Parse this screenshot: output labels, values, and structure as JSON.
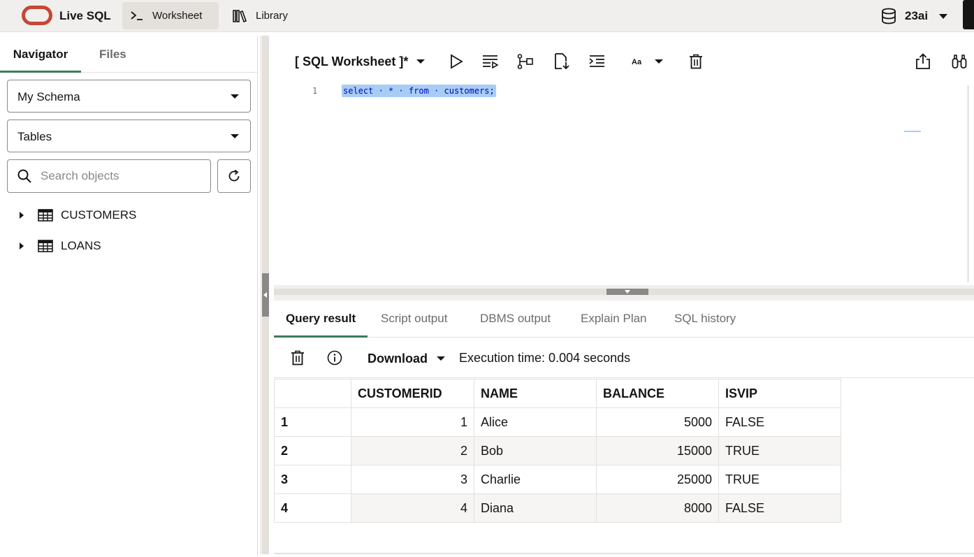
{
  "app": {
    "title": "Live SQL",
    "nav": [
      {
        "label": "Worksheet",
        "icon": "terminal-icon",
        "active": true
      },
      {
        "label": "Library",
        "icon": "library-icon",
        "active": false
      }
    ],
    "database": {
      "label": "23ai",
      "icon": "database-icon"
    }
  },
  "navigator": {
    "tabs": [
      {
        "label": "Navigator",
        "active": true
      },
      {
        "label": "Files",
        "active": false
      }
    ],
    "schema_select": "My Schema",
    "object_type_select": "Tables",
    "search": {
      "placeholder": "Search objects",
      "value": ""
    },
    "tree": [
      {
        "label": "CUSTOMERS",
        "icon": "table-icon"
      },
      {
        "label": "LOANS",
        "icon": "table-icon"
      }
    ]
  },
  "editor": {
    "title": "[ SQL Worksheet ]*",
    "font_toggle": "Aa",
    "lines": [
      {
        "number": "1",
        "code": "select · * · from · customers;"
      }
    ]
  },
  "results": {
    "tabs": [
      {
        "label": "Query result",
        "active": true
      },
      {
        "label": "Script output",
        "active": false
      },
      {
        "label": "DBMS output",
        "active": false
      },
      {
        "label": "Explain Plan",
        "active": false
      },
      {
        "label": "SQL history",
        "active": false
      }
    ],
    "download_label": "Download",
    "execution_time": "Execution time: 0.004 seconds",
    "columns": [
      "CUSTOMERID",
      "NAME",
      "BALANCE",
      "ISVIP"
    ],
    "rows": [
      {
        "n": "1",
        "customerid": "1",
        "name": "Alice",
        "balance": "5000",
        "isvip": "FALSE"
      },
      {
        "n": "2",
        "customerid": "2",
        "name": "Bob",
        "balance": "15000",
        "isvip": "TRUE"
      },
      {
        "n": "3",
        "customerid": "3",
        "name": "Charlie",
        "balance": "25000",
        "isvip": "TRUE"
      },
      {
        "n": "4",
        "customerid": "4",
        "name": "Diana",
        "balance": "8000",
        "isvip": "FALSE"
      }
    ]
  },
  "colors": {
    "brand": "#c74634",
    "active_tab_underline": "#3f7a5a",
    "selection": "#a8cdf5",
    "sql_keyword": "#0000c0"
  }
}
